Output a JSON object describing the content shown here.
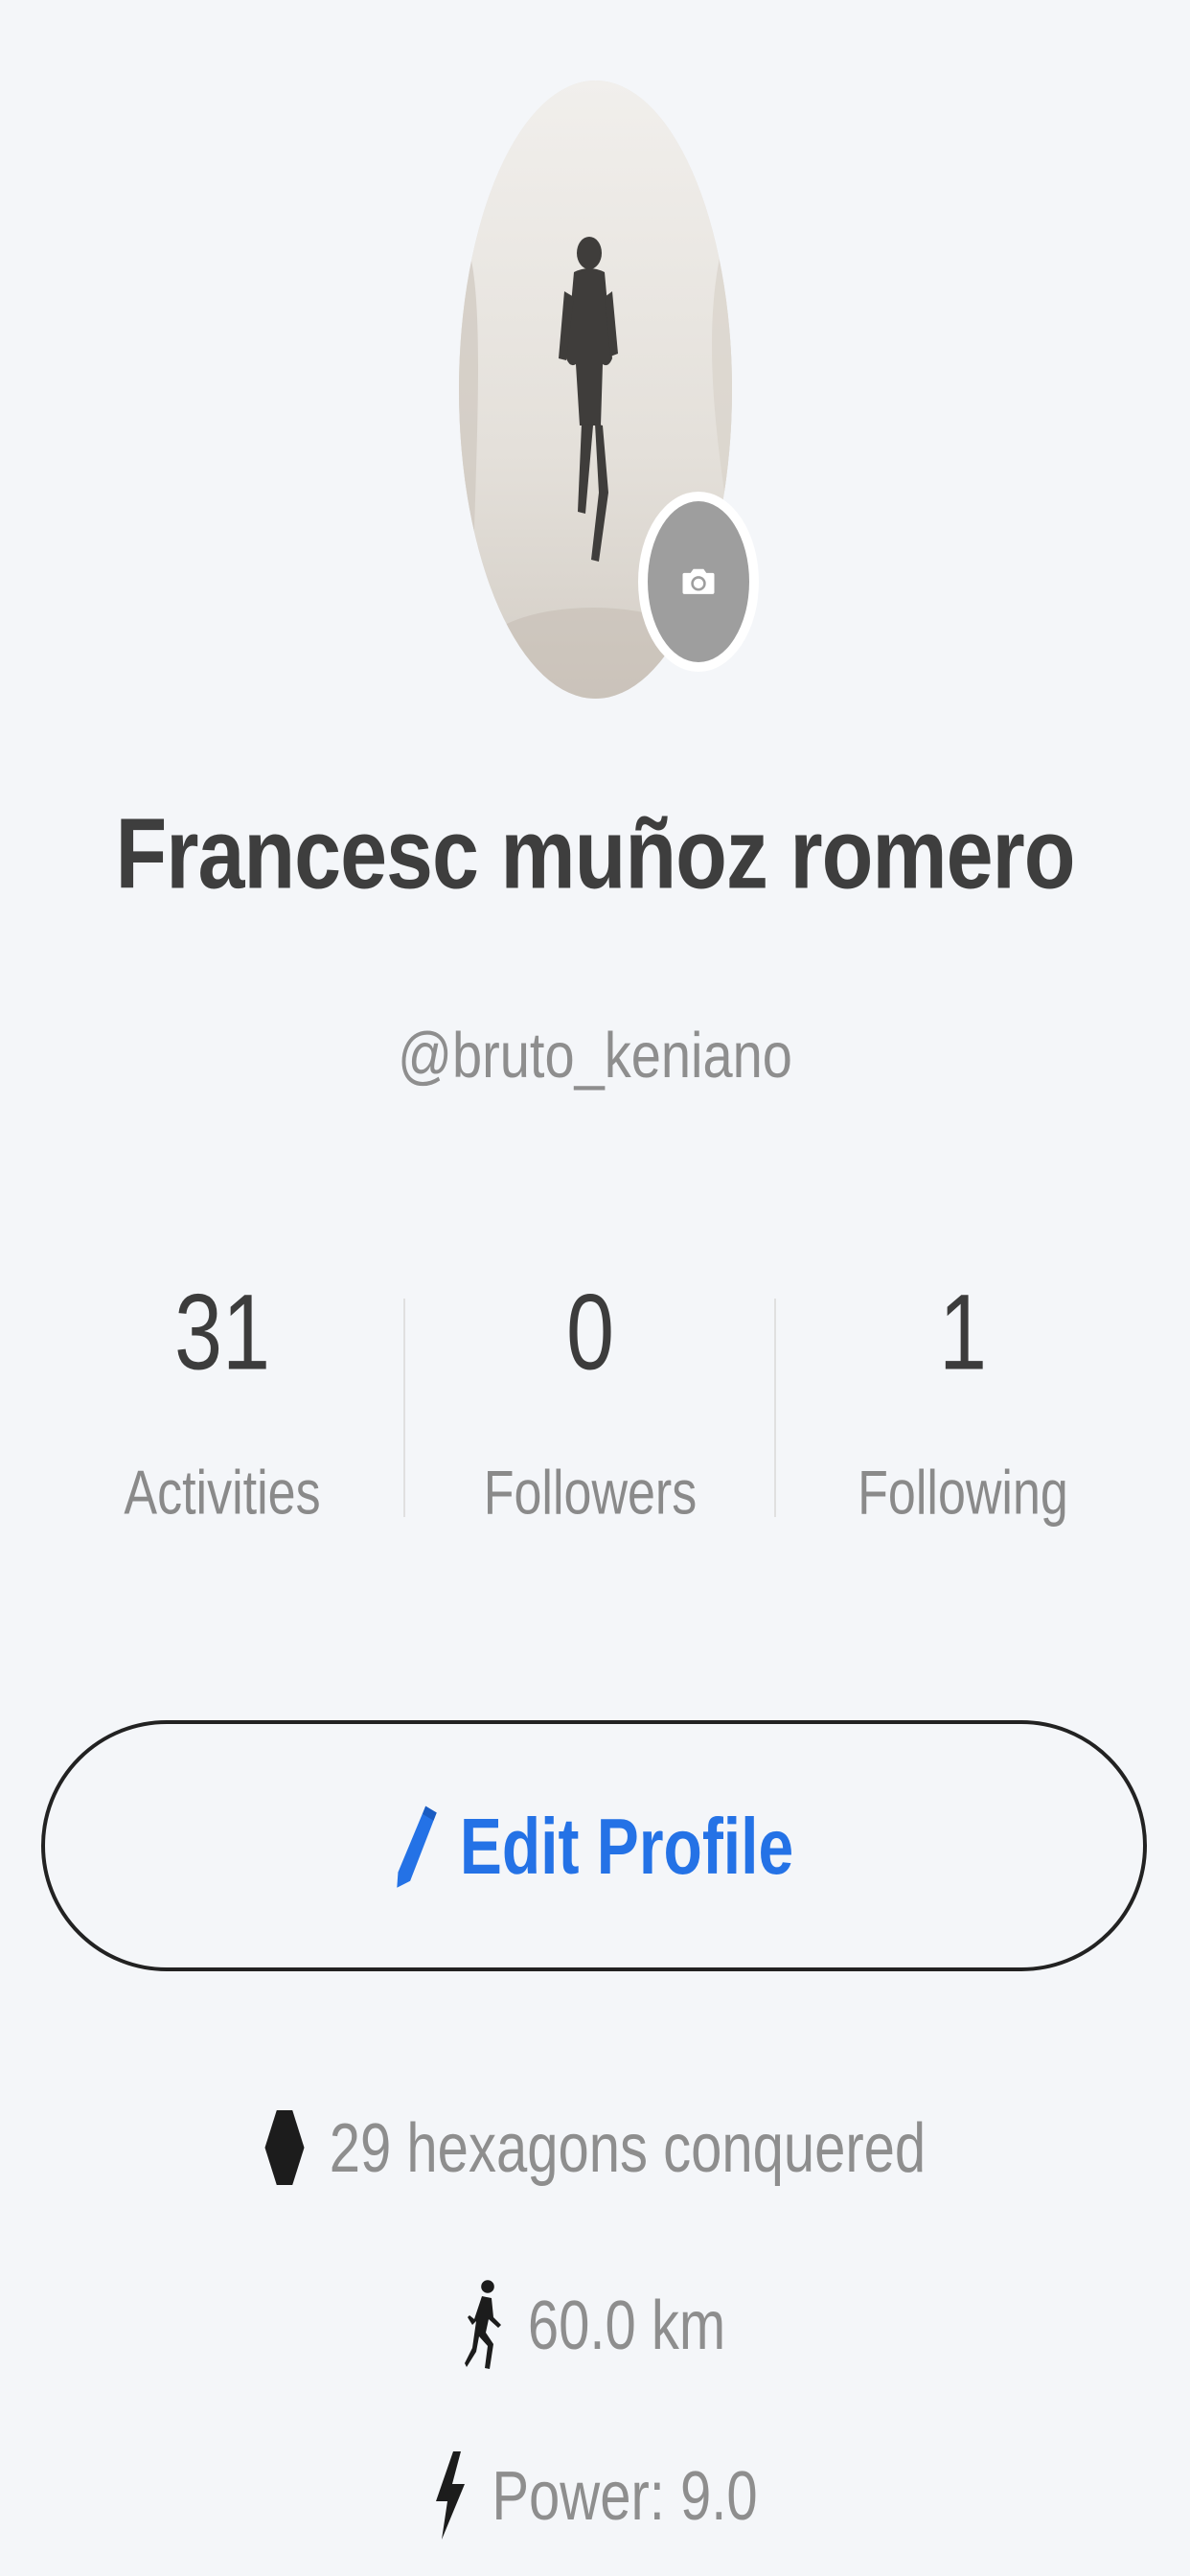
{
  "profile": {
    "name": "Francesc muñoz romero",
    "handle": "@bruto_keniano"
  },
  "stats": [
    {
      "value": "31",
      "label": "Activities"
    },
    {
      "value": "0",
      "label": "Followers"
    },
    {
      "value": "1",
      "label": "Following"
    }
  ],
  "edit_button": {
    "label": "Edit Profile",
    "icon": "pencil-icon"
  },
  "info": [
    {
      "icon": "hexagon-icon",
      "text": "29 hexagons conquered"
    },
    {
      "icon": "running-icon",
      "text": "60.0 km"
    },
    {
      "icon": "lightning-icon",
      "text": "Power: 9.0"
    }
  ],
  "colors": {
    "background": "#f4f6f9",
    "accent": "#2472e6",
    "name_text": "#3e3e3e",
    "secondary_text": "#8e8e8e",
    "camera_badge": "#9e9e9e"
  }
}
